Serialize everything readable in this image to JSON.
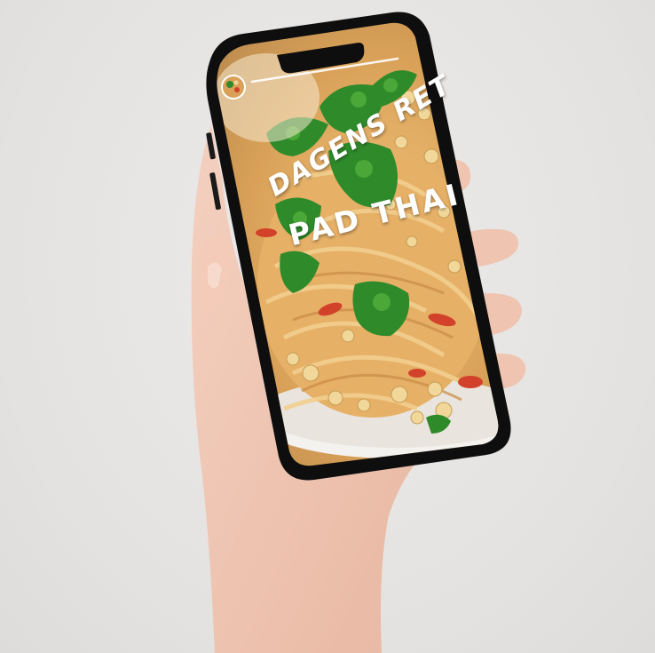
{
  "story": {
    "title_line1": "DAGENS RET",
    "title_line2": "PAD THAI"
  },
  "colors": {
    "background": "#e7e5e3",
    "phone_frame": "#111111",
    "skin": "#f0c7b4",
    "noodle": "#e9b56a",
    "cilantro": "#2f8a2a",
    "plate": "#f4f2ee"
  },
  "icons": {
    "profile_avatar": "food-avatar-icon"
  }
}
